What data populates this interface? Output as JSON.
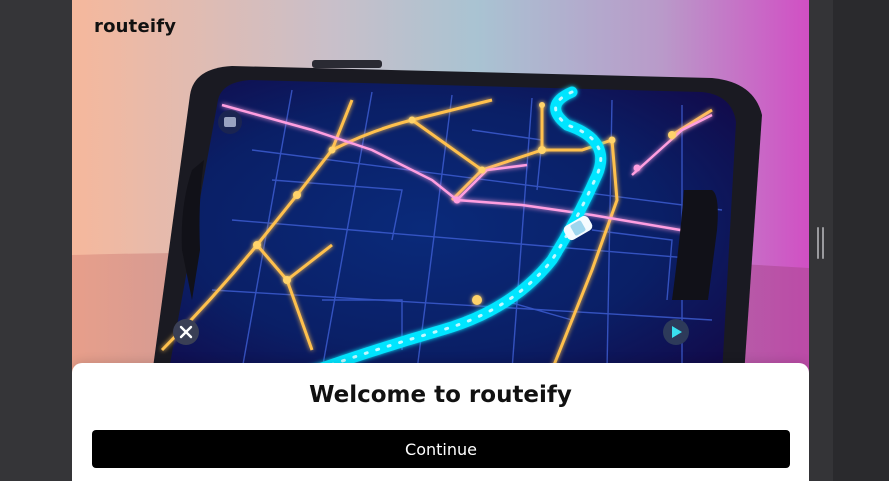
{
  "app": {
    "brand": "routeify"
  },
  "onboarding": {
    "title": "Welcome to routeify",
    "continue_label": "Continue"
  },
  "colors": {
    "accent": "#00e5ff",
    "route": "#ffc04d",
    "button_bg": "#000000"
  },
  "icons": {
    "close": "close-icon",
    "play": "play-icon",
    "car": "car-icon",
    "bag": "bag-icon"
  }
}
